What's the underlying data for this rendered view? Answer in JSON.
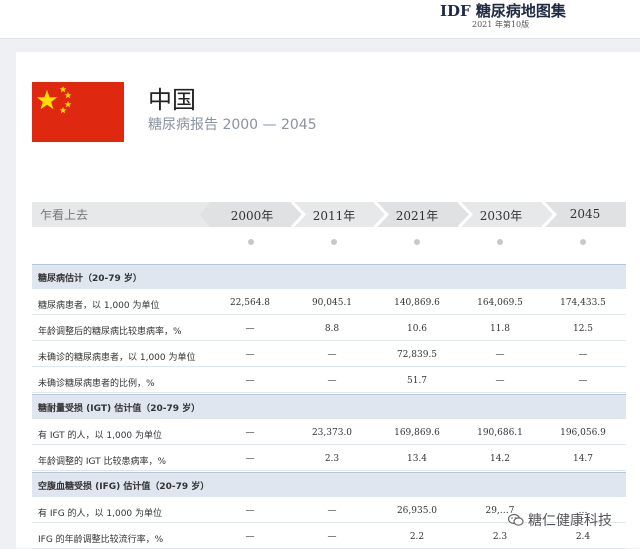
{
  "header": {
    "atlas_title": "IDF 糖尿病地图集",
    "edition": "2021 年第10版"
  },
  "country": {
    "name": "中国",
    "report": "糖尿病报告 2000 — 2045",
    "flag_icon": "china-flag-icon",
    "flag_color": "#de2910"
  },
  "timeline": {
    "label": "乍看上去",
    "years": [
      "2000年",
      "2011年",
      "2021年",
      "2030年",
      "2045"
    ]
  },
  "sections": [
    {
      "title": "糖尿病估计（20-79 岁）",
      "rows": [
        {
          "label": "糖尿病患者，以 1,000 为单位",
          "values": [
            "22,564.8",
            "90,045.1",
            "140,869.6",
            "164,069.5",
            "174,433.5"
          ]
        },
        {
          "label": "年龄调整后的糖尿病比较患病率，%",
          "values": [
            "—",
            "8.8",
            "10.6",
            "11.8",
            "12.5"
          ]
        },
        {
          "label": "未确诊的糖尿病患者，以 1,000 为单位",
          "values": [
            "—",
            "—",
            "72,839.5",
            "—",
            "—"
          ]
        },
        {
          "label": "未确诊糖尿病患者的比例，%",
          "values": [
            "—",
            "—",
            "51.7",
            "—",
            "—"
          ]
        }
      ]
    },
    {
      "title": "糖耐量受损 (IGT) 估计值（20-79 岁）",
      "rows": [
        {
          "label": "有 IGT 的人，以 1,000 为单位",
          "values": [
            "—",
            "23,373.0",
            "169,869.6",
            "190,686.1",
            "196,056.9"
          ]
        },
        {
          "label": "年龄调整的 IGT 比较患病率，%",
          "values": [
            "—",
            "2.3",
            "13.4",
            "14.2",
            "14.7"
          ]
        }
      ]
    },
    {
      "title": "空腹血糖受损 (IFG) 估计值（20-79 岁）",
      "rows": [
        {
          "label": "有 IFG 的人，以 1,000 为单位",
          "values": [
            "—",
            "—",
            "26,935.0",
            "29,…7",
            "…"
          ]
        },
        {
          "label": "IFG 的年龄调整比较流行率，%",
          "values": [
            "—",
            "—",
            "2.2",
            "2.3",
            "2.4"
          ]
        }
      ]
    }
  ],
  "watermark": {
    "text": "糖仁健康科技",
    "icon": "wechat-icon"
  }
}
